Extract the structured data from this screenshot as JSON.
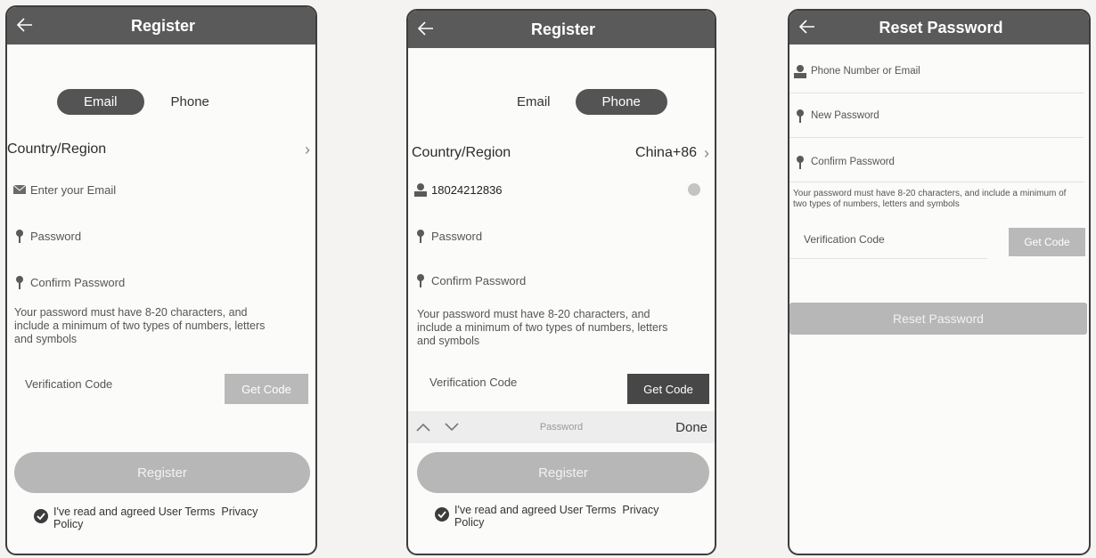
{
  "screen1": {
    "title": "Register",
    "tabs": [
      "Email",
      "Phone"
    ],
    "country_label": "Country/Region",
    "email_placeholder": "Enter your Email",
    "password_placeholder": "Password",
    "confirm_placeholder": "Confirm Password",
    "password_hint": "Your password must have 8-20 characters, and include a minimum of two types of numbers, letters and symbols",
    "verification_label": "Verification Code",
    "get_code": "Get Code",
    "register": "Register",
    "agree_prefix": "I've read and agreed User Terms",
    "agree_privacy": "Privacy Policy"
  },
  "screen2": {
    "title": "Register",
    "tabs": [
      "Email",
      "Phone"
    ],
    "country_label": "Country/Region",
    "country_value": "China+86",
    "phone_value": "18024212836",
    "password_placeholder": "Password",
    "confirm_placeholder": "Confirm Password",
    "password_hint": "Your password must have 8-20 characters, and include a minimum of two types of numbers, letters and symbols",
    "verification_label": "Verification Code",
    "get_code": "Get Code",
    "keyboard_field": "Password",
    "keyboard_done": "Done",
    "register": "Register",
    "agree_prefix": "I've read and agreed User Terms",
    "agree_privacy": "Privacy Policy"
  },
  "screen3": {
    "title": "Reset Password",
    "account_placeholder": "Phone Number or Email",
    "new_password_placeholder": "New Password",
    "confirm_placeholder": "Confirm Password",
    "password_hint": "Your password must have 8-20 characters, and include a minimum of two types of numbers, letters and symbols",
    "verification_label": "Verification Code",
    "get_code": "Get Code",
    "reset_button": "Reset Password"
  },
  "colors": {
    "titlebar": "#5a5a5a",
    "active_pill": "#545454",
    "disabled_button": "#b7b7b7",
    "dark_button": "#474747"
  }
}
